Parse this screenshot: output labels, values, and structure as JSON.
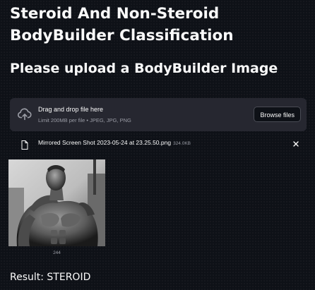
{
  "header": {
    "title": "Steroid And Non-Steroid BodyBuilder Classification",
    "subtitle": "Please upload a BodyBuilder Image"
  },
  "uploader": {
    "icon": "upload-cloud-icon",
    "main_text": "Drag and drop file here",
    "limit_text": "Limit 200MB per file • JPEG, JPG, PNG",
    "browse_label": "Browse files"
  },
  "uploaded_file": {
    "icon": "file-icon",
    "name": "Mirrored Screen Shot 2023-05-24 at 23.25.50.png",
    "size": "324.0KB",
    "remove_icon": "close-icon"
  },
  "image": {
    "description_icon": "bodybuilder-photo",
    "caption": "244"
  },
  "result": {
    "text": "Result: STEROID"
  },
  "colors": {
    "background": "#0e1117",
    "dropzone": "#262730",
    "text": "#fafafa",
    "muted": "#9a9ca5"
  }
}
